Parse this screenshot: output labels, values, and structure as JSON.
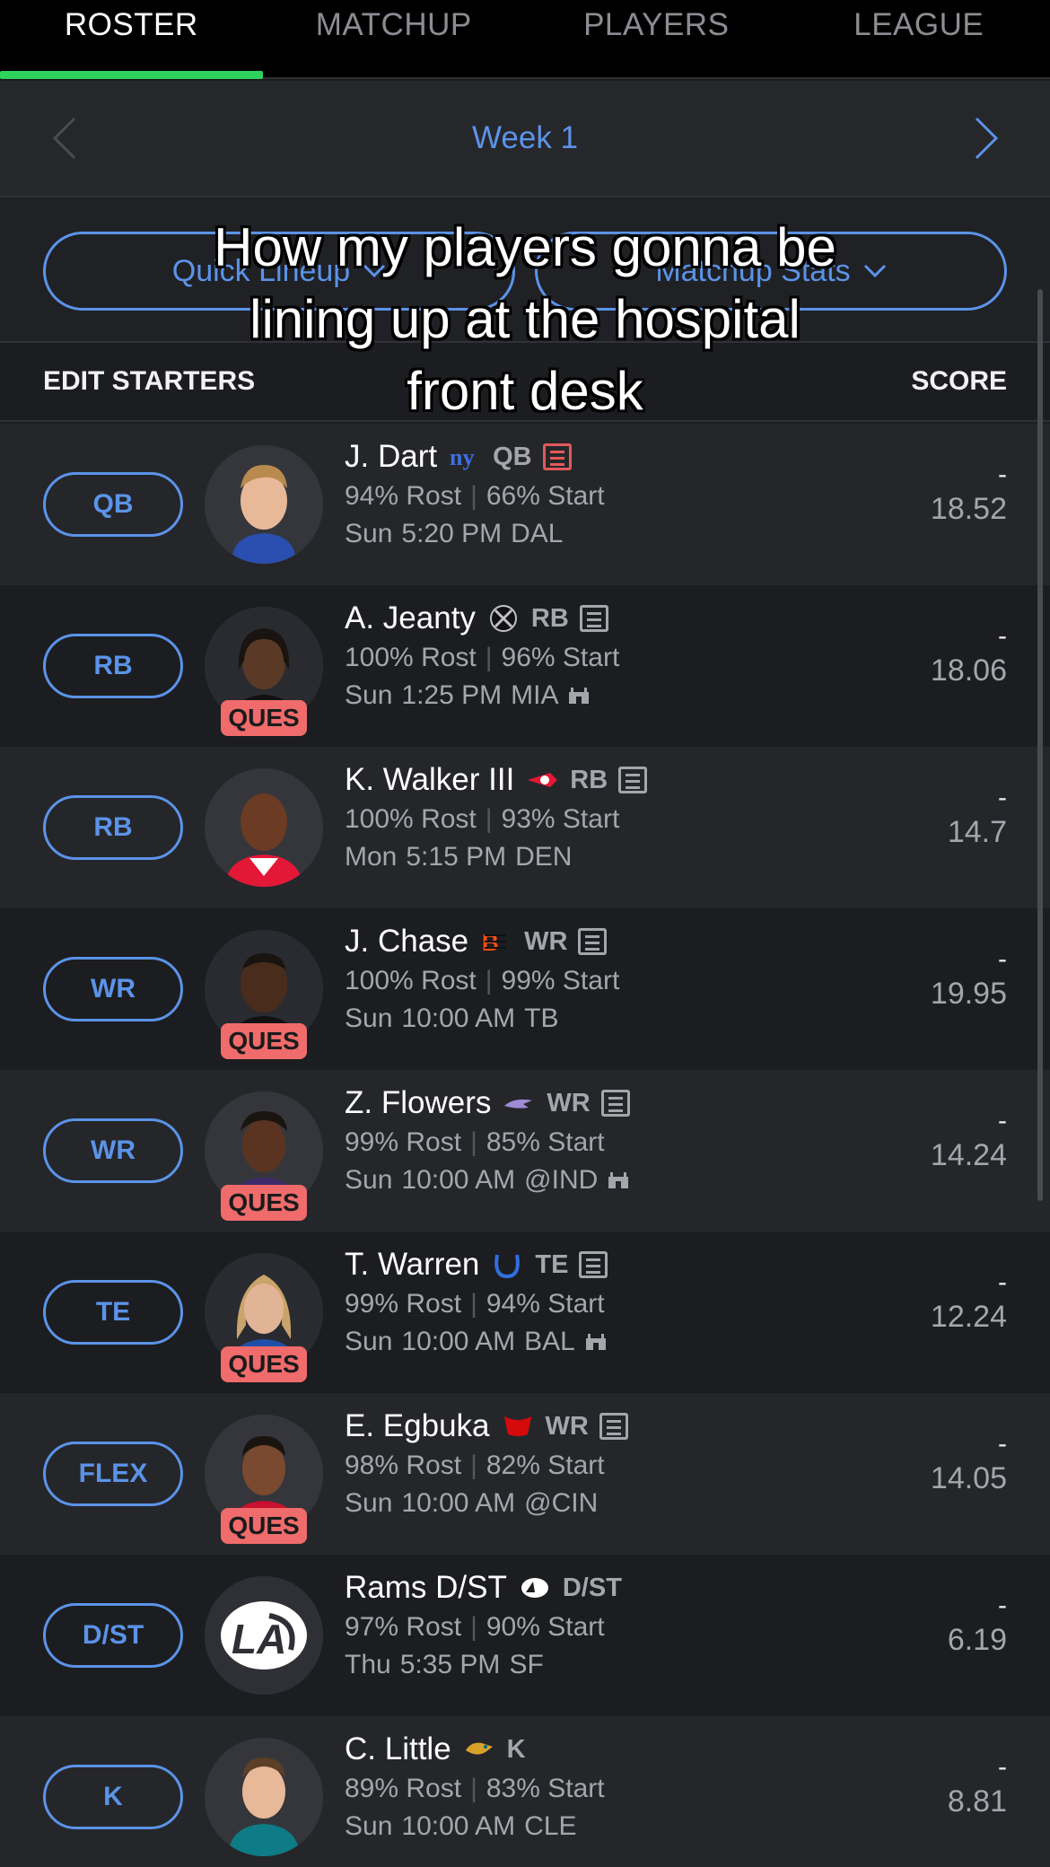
{
  "tabs": [
    {
      "label": "ROSTER",
      "active": true
    },
    {
      "label": "MATCHUP",
      "active": false
    },
    {
      "label": "PLAYERS",
      "active": false
    },
    {
      "label": "LEAGUE",
      "active": false
    }
  ],
  "week_nav": {
    "title": "Week 1"
  },
  "actions": {
    "quick_lineup": "Quick Lineup",
    "matchup_stats": "Matchup Stats"
  },
  "header": {
    "edit_starters": "EDIT STARTERS",
    "score": "SCORE"
  },
  "caption": {
    "line1": "How my players gonna be",
    "line2": "lining up at the hospital",
    "line3": "front desk"
  },
  "players": [
    {
      "slot": "QB",
      "name": "J. Dart",
      "pos": "QB",
      "team_logo": "giants-logo",
      "rost": "94% Rost",
      "start": "66% Start",
      "day": "Sun",
      "time": "5:20 PM",
      "opp": "DAL",
      "score": "-",
      "proj": "18.52",
      "status": "",
      "news_alert": true,
      "weather": false
    },
    {
      "slot": "RB",
      "name": "A. Jeanty",
      "pos": "RB",
      "team_logo": "raiders-logo",
      "rost": "100% Rost",
      "start": "96% Start",
      "day": "Sun",
      "time": "1:25 PM",
      "opp": "MIA",
      "score": "-",
      "proj": "18.06",
      "status": "QUES",
      "news_alert": false,
      "weather": true
    },
    {
      "slot": "RB",
      "name": "K. Walker III",
      "pos": "RB",
      "team_logo": "chiefs-logo",
      "rost": "100% Rost",
      "start": "93% Start",
      "day": "Mon",
      "time": "5:15 PM",
      "opp": "DEN",
      "score": "-",
      "proj": "14.7",
      "status": "",
      "news_alert": false,
      "weather": false
    },
    {
      "slot": "WR",
      "name": "J. Chase",
      "pos": "WR",
      "team_logo": "bengals-logo",
      "rost": "100% Rost",
      "start": "99% Start",
      "day": "Sun",
      "time": "10:00 AM",
      "opp": "TB",
      "score": "-",
      "proj": "19.95",
      "status": "QUES",
      "news_alert": false,
      "weather": false
    },
    {
      "slot": "WR",
      "name": "Z. Flowers",
      "pos": "WR",
      "team_logo": "ravens-logo",
      "rost": "99% Rost",
      "start": "85% Start",
      "day": "Sun",
      "time": "10:00 AM",
      "opp": "@IND",
      "score": "-",
      "proj": "14.24",
      "status": "QUES",
      "news_alert": false,
      "weather": true
    },
    {
      "slot": "TE",
      "name": "T. Warren",
      "pos": "TE",
      "team_logo": "colts-logo",
      "rost": "99% Rost",
      "start": "94% Start",
      "day": "Sun",
      "time": "10:00 AM",
      "opp": "BAL",
      "score": "-",
      "proj": "12.24",
      "status": "QUES",
      "news_alert": false,
      "weather": true
    },
    {
      "slot": "FLEX",
      "name": "E. Egbuka",
      "pos": "WR",
      "team_logo": "buccaneers-logo",
      "rost": "98% Rost",
      "start": "82% Start",
      "day": "Sun",
      "time": "10:00 AM",
      "opp": "@CIN",
      "score": "-",
      "proj": "14.05",
      "status": "QUES",
      "news_alert": false,
      "weather": false
    },
    {
      "slot": "D/ST",
      "name": "Rams D/ST",
      "pos": "D/ST",
      "team_logo": "rams-logo",
      "rost": "97% Rost",
      "start": "90% Start",
      "day": "Thu",
      "time": "5:35 PM",
      "opp": "SF",
      "score": "-",
      "proj": "6.19",
      "status": "",
      "news_alert": false,
      "weather": false
    },
    {
      "slot": "K",
      "name": "C. Little",
      "pos": "K",
      "team_logo": "jaguars-logo",
      "rost": "89% Rost",
      "start": "83% Start",
      "day": "Sun",
      "time": "10:00 AM",
      "opp": "CLE",
      "score": "-",
      "proj": "8.81",
      "status": "",
      "news_alert": false,
      "weather": false
    }
  ]
}
